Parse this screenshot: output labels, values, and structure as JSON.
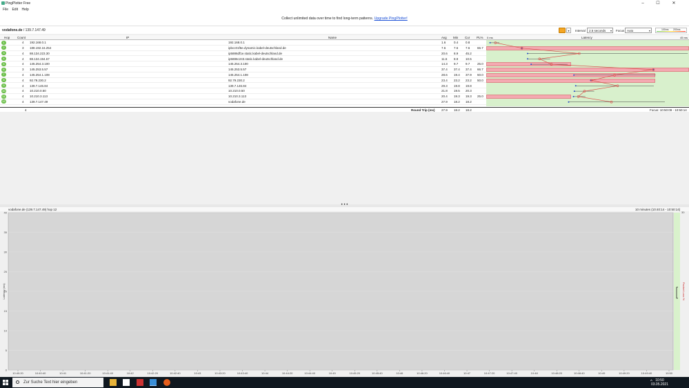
{
  "window": {
    "title": "PingPlotter Free",
    "minimize": "–",
    "maximize": "☐",
    "close": "✕"
  },
  "menu": [
    "File",
    "Edit",
    "Help"
  ],
  "banner": {
    "text": "Collect unlimited data over time to find long-term patterns.",
    "link": "Upgrade PingPlotter!"
  },
  "toolbar": {
    "target_name": "vodafone.de",
    "target_ip": " / 139.7.147.49",
    "interval_label": "Interval",
    "interval_value": "2.5 seconds",
    "focus_label": "Focus",
    "focus_value": "Auto",
    "scale_low": "100ms",
    "scale_high": "200ms"
  },
  "columns": {
    "hop": "Hop",
    "count": "Count",
    "ip": "IP",
    "name": "Name",
    "avg": "Avg",
    "min": "Min",
    "cur": "Cur",
    "pl": "PL%",
    "latency": "Latency",
    "lat_min": "0 ms",
    "lat_max": "45 ms"
  },
  "rows": [
    {
      "hop": "1",
      "count": "4",
      "ip": "192.168.0.1",
      "name": "192.168.0.1",
      "avg": "1.6",
      "min": "0.4",
      "cur": "0.8",
      "pl": "",
      "avgv": 1.6,
      "minv": 0.4,
      "maxv": 2.5,
      "plv": 0
    },
    {
      "hop": "2",
      "count": "3",
      "ip": "188.192.16.254",
      "name": "ipbcc01f6e.dynamic.kabel-deutschland.de",
      "avg": "7.6",
      "min": "7.6",
      "cur": "7.6",
      "pl": "66.7",
      "avgv": 7.6,
      "minv": 7.6,
      "maxv": 7.6,
      "plv": 66.7
    },
    {
      "hop": "3",
      "count": "4",
      "ip": "88.134.223.30",
      "name": "ip5886df1e.static.kabel-deutschland.de",
      "avg": "20.6",
      "min": "8.9",
      "cur": "45.2",
      "pl": "",
      "avgv": 20.6,
      "minv": 8.9,
      "maxv": 45.2,
      "plv": 0
    },
    {
      "hop": "4",
      "count": "4",
      "ip": "88.134.194.67",
      "name": "ip5886c243.static.kabel-deutschland.de",
      "avg": "11.6",
      "min": "8.9",
      "cur": "10.5",
      "pl": "",
      "avgv": 11.6,
      "minv": 8.9,
      "maxv": 14,
      "plv": 0
    },
    {
      "hop": "5",
      "count": "4",
      "ip": "145.254.3.100",
      "name": "145.254.3.100",
      "avg": "14.3",
      "min": "9.7",
      "cur": "9.7",
      "pl": "25.0",
      "avgv": 14.3,
      "minv": 9.7,
      "maxv": 18,
      "plv": 25
    },
    {
      "hop": "6",
      "count": "3",
      "ip": "145.253.5.57",
      "name": "145.253.5.57",
      "avg": "37.4",
      "min": "37.4",
      "cur": "37.4",
      "pl": "66.7",
      "avgv": 37.4,
      "minv": 37.4,
      "maxv": 37.4,
      "plv": 66.7
    },
    {
      "hop": "7",
      "count": "4",
      "ip": "145.254.1.108",
      "name": "145.254.1.108",
      "avg": "28.6",
      "min": "19.4",
      "cur": "37.9",
      "pl": "50.0",
      "avgv": 28.6,
      "minv": 19.4,
      "maxv": 37.9,
      "plv": 50
    },
    {
      "hop": "8",
      "count": "4",
      "ip": "92.79.230.2",
      "name": "92.79.230.2",
      "avg": "23.4",
      "min": "23.2",
      "cur": "23.2",
      "pl": "50.0",
      "avgv": 23.4,
      "minv": 23.2,
      "maxv": 23.6,
      "plv": 50
    },
    {
      "hop": "9",
      "count": "4",
      "ip": "139.7.146.84",
      "name": "139.7.146.84",
      "avg": "29.3",
      "min": "19.8",
      "cur": "19.8",
      "pl": "",
      "avgv": 29.3,
      "minv": 19.8,
      "maxv": 37.5,
      "plv": 0
    },
    {
      "hop": "10",
      "count": "4",
      "ip": "10.210.0.50",
      "name": "10.210.0.50",
      "avg": "21.8",
      "min": "19.5",
      "cur": "20.3",
      "pl": "",
      "avgv": 21.8,
      "minv": 19.5,
      "maxv": 24,
      "plv": 0
    },
    {
      "hop": "11",
      "count": "4",
      "ip": "10.210.3.113",
      "name": "10.210.3.113",
      "avg": "20.4",
      "min": "19.3",
      "cur": "19.3",
      "pl": "25.0",
      "avgv": 20.4,
      "minv": 19.3,
      "maxv": 22,
      "plv": 25
    },
    {
      "hop": "12",
      "count": "4",
      "ip": "139.7.147.49",
      "name": "vodafone.de",
      "avg": "27.9",
      "min": "18.2",
      "cur": "18.2",
      "pl": "",
      "avgv": 27.9,
      "minv": 18.2,
      "maxv": 40,
      "plv": 0
    }
  ],
  "totals": {
    "count": "4",
    "label": "Round Trip (ms)",
    "avg": "27.9",
    "min": "18.2",
    "cur": "18.2",
    "focus": "Focus: 10:50:09 - 10:50:14"
  },
  "graph": {
    "header": "vodafone.de (139.7.147.49) hop 12",
    "range": "10 minutes (10:40:14 - 10:50:14)",
    "pl_top": "30",
    "ylabel": "Latency (ms)",
    "y2label": "Packet Loss %",
    "splitter": "• • •"
  },
  "chart_data": {
    "type": "line",
    "title": "",
    "xlabel": "",
    "ylabel": "Latency (ms)",
    "y2label": "Packet Loss %",
    "ylim": [
      0,
      40
    ],
    "y_ticks": [
      "40",
      "35",
      "30",
      "25",
      "20",
      "15",
      "10",
      "5",
      "0"
    ],
    "x": [
      "10:40:20",
      "10:40:40",
      "10:41",
      "10:41:20",
      "10:41:40",
      "10:42",
      "10:42:20",
      "10:42:40",
      "10:43",
      "10:43:20",
      "10:43:40",
      "10:44",
      "10:44:20",
      "10:44:40",
      "10:45",
      "10:45:20",
      "10:45:40",
      "10:46",
      "10:46:20",
      "10:46:40",
      "10:47",
      "10:47:20",
      "10:47:40",
      "10:48",
      "10:48:20",
      "10:48:40",
      "10:49",
      "10:49:20",
      "10:49:40",
      "10:50"
    ],
    "series": []
  },
  "taskbar": {
    "search_placeholder": "Zur Suche Text hier eingeben",
    "time": "10:50",
    "date": "03.05.2021"
  },
  "colors": {
    "hop_ok": "#6cbf4a",
    "latency_bg": "#d8f0cc",
    "loss_bar": "#f4a9b1",
    "avg_line": "#d9534f",
    "accent": "#f5a623"
  }
}
